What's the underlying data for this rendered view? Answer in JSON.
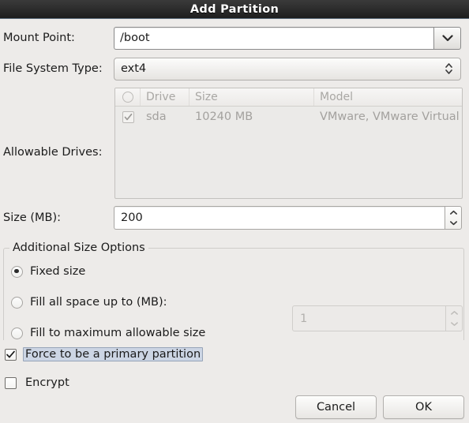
{
  "window": {
    "title": "Add Partition"
  },
  "fields": {
    "mount_point": {
      "label": "Mount Point:",
      "value": "/boot",
      "dropdown_icon": "chevron-down-icon"
    },
    "file_system_type": {
      "label": "File System Type:",
      "value": "ext4",
      "spinner_icon": "chevron-up-down-icon"
    },
    "allowable_drives": {
      "label": "Allowable Drives:",
      "columns": [
        "",
        "Drive",
        "Size",
        "Model"
      ],
      "header_select_icon": "select-all-circle-icon",
      "rows": [
        {
          "checked": true,
          "drive": "sda",
          "size": "10240 MB",
          "model": "VMware, VMware Virtual S"
        }
      ]
    },
    "size_mb": {
      "label": "Size (MB):",
      "value": "200",
      "up_icon": "chevron-up-icon",
      "down_icon": "chevron-down-icon"
    }
  },
  "additional_size_options": {
    "title": "Additional Size Options",
    "options": [
      {
        "label": "Fixed size",
        "selected": true
      },
      {
        "label": "Fill all space up to (MB):",
        "selected": false
      },
      {
        "label": "Fill to maximum allowable size",
        "selected": false
      }
    ],
    "fill_up_to": {
      "value": "1",
      "enabled": false,
      "up_icon": "chevron-up-icon",
      "down_icon": "chevron-down-icon"
    }
  },
  "checkboxes": [
    {
      "label": "Force to be a primary partition",
      "checked": true,
      "focused": true,
      "check_icon": "checkmark-icon"
    },
    {
      "label": "Encrypt",
      "checked": false,
      "focused": false,
      "check_icon": "checkmark-icon"
    }
  ],
  "actions": {
    "cancel": "Cancel",
    "ok": "OK"
  },
  "colors": {
    "dialog_background": "#edebe9",
    "titlebar_start": "#3a3a3a",
    "titlebar_end": "#1d1d1d",
    "titlebar_text": "#ffffff",
    "focus_highlight": "#ccd5e4",
    "disabled_text": "#a3a19e"
  }
}
